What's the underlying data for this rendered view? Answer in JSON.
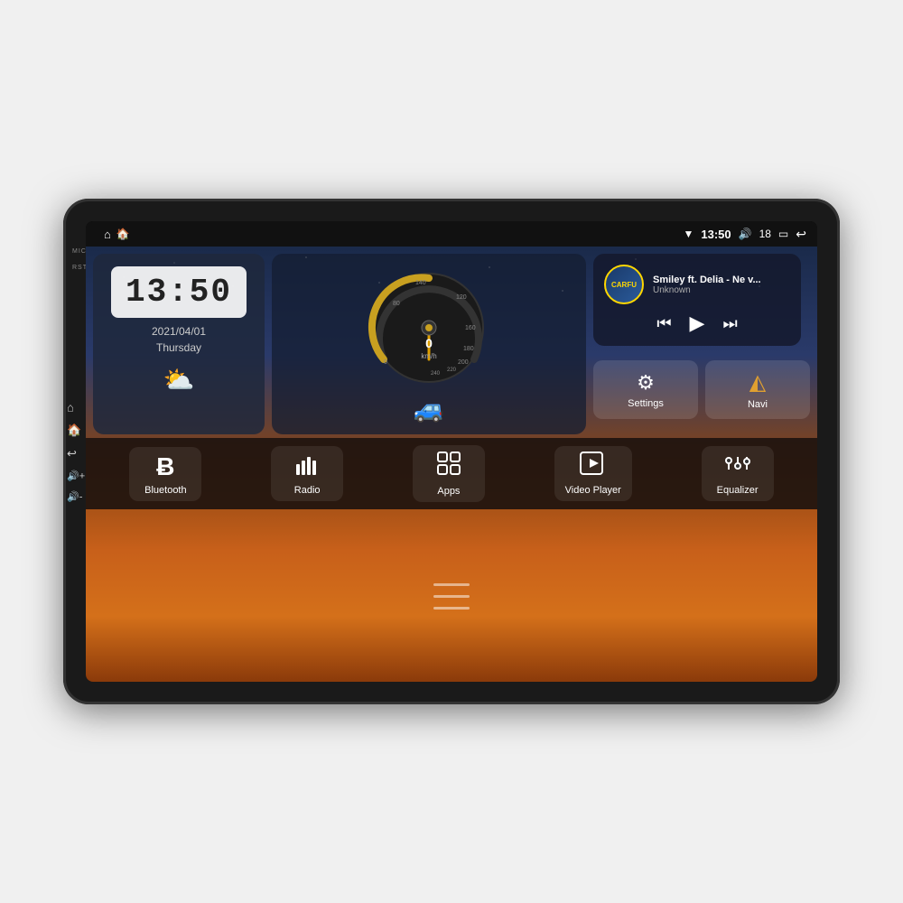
{
  "device": {
    "label": "Car Head Unit"
  },
  "status_bar": {
    "wifi_icon": "▼",
    "time": "13:50",
    "volume_icon": "🔊",
    "volume_level": "18",
    "battery_icon": "🔋",
    "back_icon": "↩",
    "home_icon": "⌂",
    "app_icon": "▦"
  },
  "clock": {
    "time": "13:50",
    "date": "2021/04/01",
    "day": "Thursday",
    "weather": "⛅"
  },
  "speedometer": {
    "speed": "0",
    "unit": "km/h",
    "max": "240"
  },
  "music": {
    "logo_text": "CARFU",
    "title": "Smiley ft. Delia - Ne v...",
    "artist": "Unknown",
    "prev_icon": "⏮",
    "play_icon": "▶",
    "next_icon": "⏭"
  },
  "quick_buttons": [
    {
      "id": "settings",
      "icon": "⚙",
      "label": "Settings"
    },
    {
      "id": "navi",
      "icon": "▲",
      "label": "Navi"
    }
  ],
  "bottom_items": [
    {
      "id": "bluetooth",
      "icon": "Ƀ",
      "label": "Bluetooth"
    },
    {
      "id": "radio",
      "icon": "📶",
      "label": "Radio"
    },
    {
      "id": "apps",
      "icon": "⊞",
      "label": "Apps"
    },
    {
      "id": "video",
      "icon": "📺",
      "label": "Video Player"
    },
    {
      "id": "equalizer",
      "icon": "🎛",
      "label": "Equalizer"
    }
  ],
  "side_labels": {
    "mic": "MIC",
    "rst": "RST"
  }
}
